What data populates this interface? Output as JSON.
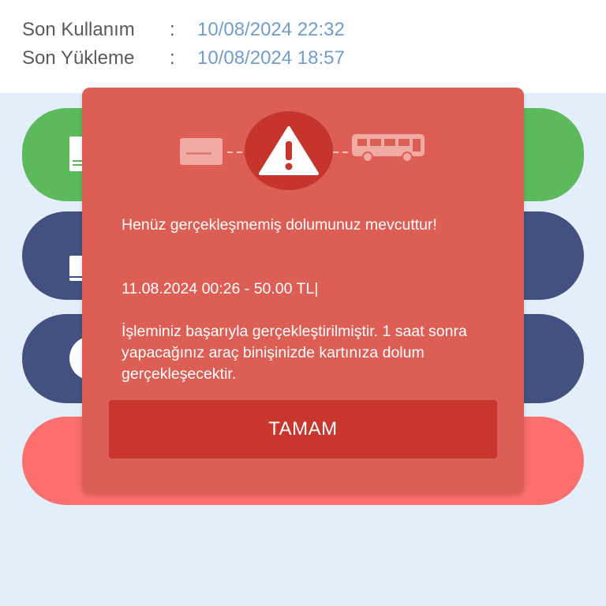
{
  "card_info": {
    "last_use": {
      "label": "Son Kullanım",
      "separator": ":",
      "value": "10/08/2024 22:32"
    },
    "last_load": {
      "label": "Son Yükleme",
      "separator": ":",
      "value": "10/08/2024 18:57"
    }
  },
  "action_buttons": [
    {
      "color": "#5cba5c",
      "icon": "card-icon"
    },
    {
      "color": "#435180",
      "icon": "card-icon"
    },
    {
      "color": "#435180",
      "icon": "circle-icon"
    },
    {
      "color": "#fb6e6e",
      "icon": "unknown-icon"
    }
  ],
  "dialog": {
    "background": "#dd5e55",
    "icons": [
      "card-icon",
      "warning-icon",
      "bus-icon"
    ],
    "message_title": "Henüz gerçekleşmemiş dolumunuz mevcuttur!",
    "pending_load": "11.08.2024 00:26 - 50.00 TL|",
    "message_body": "İşleminiz başarıyla gerçekleştirilmiştir. 1 saat sonra yapacağınız araç binişinizde kartınıza dolum gerçekleşecektir.",
    "ok_button": "TAMAM",
    "button_color": "#c8372d"
  }
}
